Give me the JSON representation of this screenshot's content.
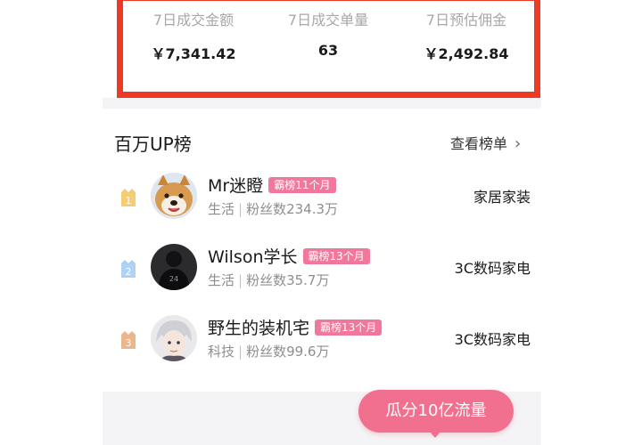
{
  "stats": [
    {
      "label": "7日成交金额",
      "value": "￥7,341.42"
    },
    {
      "label": "7日成交单量",
      "value": "63"
    },
    {
      "label": "7日预估佣金",
      "value": "￥2,492.84"
    }
  ],
  "ranking": {
    "title": "百万UP榜",
    "view_all": "查看榜单",
    "rows": [
      {
        "rank": "1",
        "name": "Mr迷瞪",
        "badge": "霸榜11个月",
        "field": "生活",
        "fans": "粉丝数234.3万",
        "category": "家居家装",
        "medal_color": "#f3c15c",
        "avatar": "shiba-avatar"
      },
      {
        "rank": "2",
        "name": "Wilson学长",
        "badge": "霸榜13个月",
        "field": "生活",
        "fans": "粉丝数35.7万",
        "category": "3C数码家电",
        "medal_color": "#9cc7f0",
        "avatar": "dark-figure-avatar"
      },
      {
        "rank": "3",
        "name": "野生的装机宅",
        "badge": "霸榜13个月",
        "field": "科技",
        "fans": "粉丝数99.6万",
        "category": "3C数码家电",
        "medal_color": "#e6a77a",
        "avatar": "anime-avatar"
      }
    ]
  },
  "promo": {
    "label": "瓜分10亿流量"
  },
  "colors": {
    "highlight_border": "#ee3a24",
    "badge": "#f2779c",
    "promo": "#f2708f"
  }
}
